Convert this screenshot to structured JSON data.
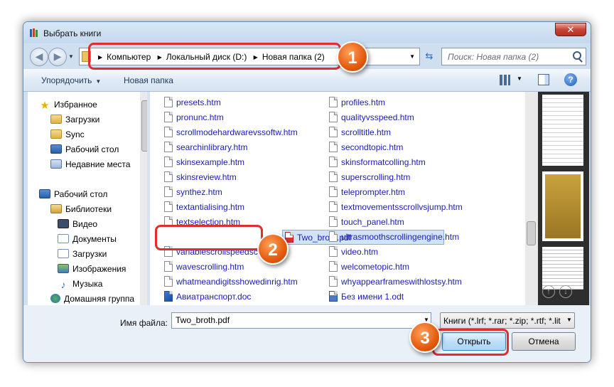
{
  "window": {
    "title": "Выбрать книги",
    "close_label": "✕"
  },
  "address": {
    "crumbs": [
      "Компьютер",
      "Локальный диск (D:)",
      "Новая папка (2)"
    ],
    "search_placeholder": "Поиск: Новая папка (2)"
  },
  "toolbar": {
    "organize_label": "Упорядочить",
    "new_folder_label": "Новая папка",
    "help_label": "?"
  },
  "nav": {
    "items": [
      {
        "label": "Избранное",
        "icon": "star-icon"
      },
      {
        "label": "Загрузки",
        "icon": "folder-icon"
      },
      {
        "label": "Sync",
        "icon": "folder-icon"
      },
      {
        "label": "Рабочий стол",
        "icon": "desktop-icon"
      },
      {
        "label": "Недавние места",
        "icon": "recent-places-icon"
      },
      {
        "label": "Рабочий стол",
        "icon": "desktop-icon"
      },
      {
        "label": "Библиотеки",
        "icon": "library-icon"
      },
      {
        "label": "Видео",
        "icon": "video-icon"
      },
      {
        "label": "Документы",
        "icon": "documents-icon"
      },
      {
        "label": "Загрузки",
        "icon": "downloads-icon"
      },
      {
        "label": "Изображения",
        "icon": "images-icon"
      },
      {
        "label": "Музыка",
        "icon": "music-icon"
      },
      {
        "label": "Домашняя группа",
        "icon": "homegroup-icon"
      }
    ]
  },
  "files": {
    "col1": [
      "presets.htm",
      "pronunc.htm",
      "scrollmodehardwarevssoftw.htm",
      "searchinlibrary.htm",
      "skinsexample.htm",
      "skinsreview.htm",
      "synthez.htm",
      "textantialising.htm",
      "textselection.htm",
      "Two_broth.pdf",
      "variablescrollspeedscr",
      "wavescrolling.htm",
      "whatmeandigitsshowedinrig.htm",
      "Авиатранспорт.doc"
    ],
    "col2": [
      "profiles.htm",
      "qualityvsspeed.htm",
      "scrolltitle.htm",
      "secondtopic.htm",
      "skinsformatcolling.htm",
      "superscrolling.htm",
      "teleprompter.htm",
      "textmovementsscrollvsjump.htm",
      "touch_panel.htm",
      "ultrasmoothscrollingengine.htm",
      "video.htm",
      "welcometopic.htm",
      "whyappearframeswithlostsy.htm",
      "Без имени 1.odt"
    ],
    "selected": "Two_broth.pdf"
  },
  "bottom": {
    "filename_label": "Имя файла:",
    "filename_value": "Two_broth.pdf",
    "filetype_value": "Книги (*.lrf; *.rar; *.zip; *.rtf; *.lit",
    "open_label": "Открыть",
    "cancel_label": "Отмена"
  },
  "markers": [
    "1",
    "2",
    "3"
  ],
  "colors": {
    "accent": "#e02d2d",
    "marker": "#e35b0f",
    "link": "#1b1bb3"
  }
}
